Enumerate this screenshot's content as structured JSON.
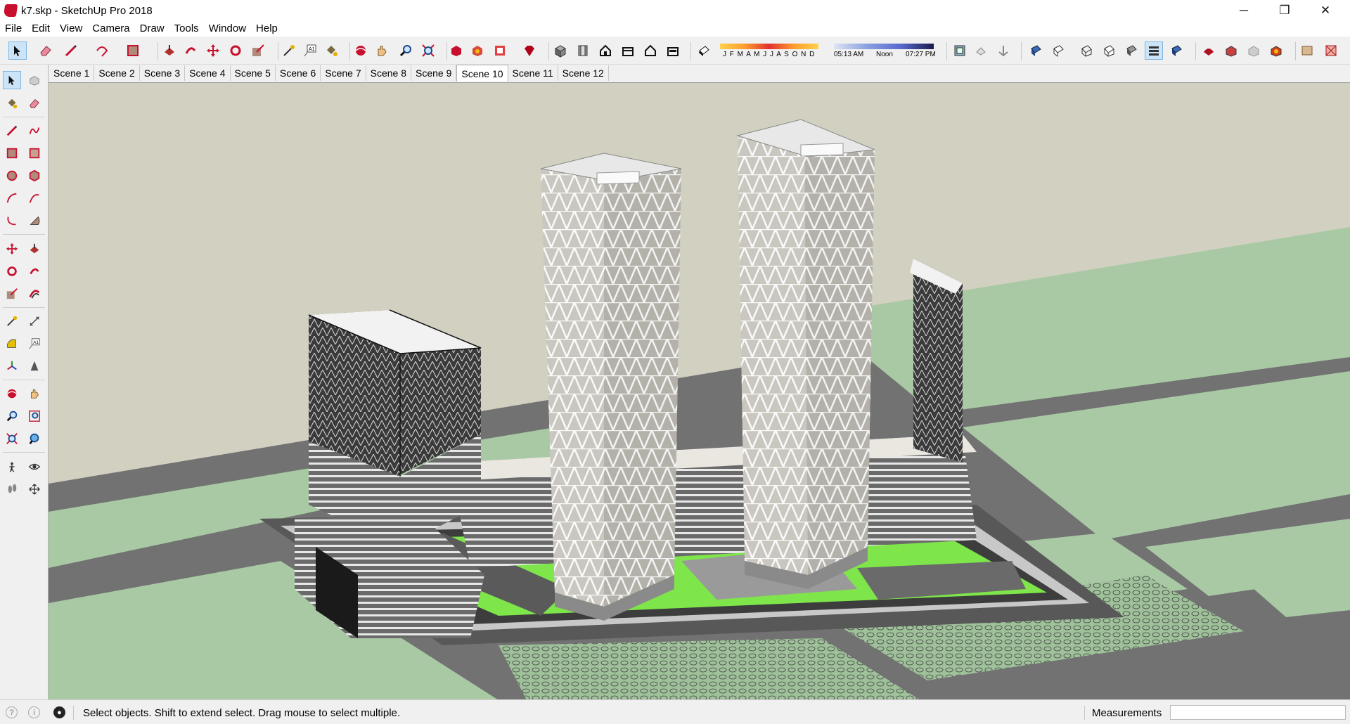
{
  "window": {
    "title": "k7.skp - SketchUp Pro 2018",
    "minimize": "─",
    "restore": "❐",
    "close": "✕"
  },
  "menu": [
    "File",
    "Edit",
    "View",
    "Camera",
    "Draw",
    "Tools",
    "Window",
    "Help"
  ],
  "shadows": {
    "months": "J F M A M J J A S O N D",
    "sunrise": "05:13 AM",
    "noon": "Noon",
    "sunset": "07:27 PM"
  },
  "scenes": {
    "tabs": [
      "Scene 1",
      "Scene 2",
      "Scene 3",
      "Scene 4",
      "Scene 5",
      "Scene 6",
      "Scene 7",
      "Scene 8",
      "Scene 9",
      "Scene 10",
      "Scene 11",
      "Scene 12"
    ],
    "active": "Scene 10"
  },
  "status": {
    "message": "Select objects. Shift to extend select. Drag mouse to select multiple.",
    "measurements_label": "Measurements",
    "measurements_value": ""
  },
  "colors": {
    "accent_red": "#c8102e",
    "ground": "#a9c9a5",
    "lawn": "#7ee64a",
    "road": "#6f6f6f",
    "sky": "#d2d0c0"
  },
  "icons": {
    "toolbar": [
      "select-icon",
      "eraser-icon",
      "pencil-icon",
      "lasso-icon",
      "rectangle-icon",
      "push-pull-icon",
      "follow-me-icon",
      "move-icon",
      "rotate-icon",
      "scale-icon",
      "tape-measure-icon",
      "text-icon",
      "paint-bucket-icon",
      "orbit-icon",
      "pan-icon",
      "zoom-icon",
      "zoom-extents-icon",
      "warehouse-icon",
      "extension-warehouse-icon",
      "layout-icon",
      "ruby-icon",
      "iso-view-icon",
      "top-view-icon",
      "front-view-icon",
      "right-view-icon",
      "back-view-icon",
      "left-view-icon",
      "shadows-icon",
      "xray-icon",
      "back-edges-icon",
      "wireframe-icon",
      "hidden-line-icon",
      "shaded-icon",
      "textured-icon",
      "monochrome-icon",
      "sandbox-icon",
      "components-icon",
      "solid-tools-icon"
    ],
    "left": [
      "select-icon",
      "make-component-icon",
      "paint-bucket-icon",
      "eraser-icon",
      "line-icon",
      "freehand-icon",
      "rectangle-icon",
      "rotated-rectangle-icon",
      "circle-icon",
      "polygon-icon",
      "arc-icon",
      "two-point-arc-icon",
      "three-point-arc-icon",
      "pie-icon",
      "move-icon",
      "push-pull-icon",
      "rotate-icon",
      "follow-me-icon",
      "scale-icon",
      "offset-icon",
      "tape-measure-icon",
      "dimension-icon",
      "protractor-icon",
      "text-icon",
      "axes-icon",
      "3d-text-icon",
      "orbit-icon",
      "pan-icon",
      "zoom-icon",
      "zoom-window-icon",
      "zoom-extents-icon",
      "previous-view-icon",
      "position-camera-icon",
      "look-around-icon",
      "walk-icon",
      "section-plane-icon"
    ]
  }
}
